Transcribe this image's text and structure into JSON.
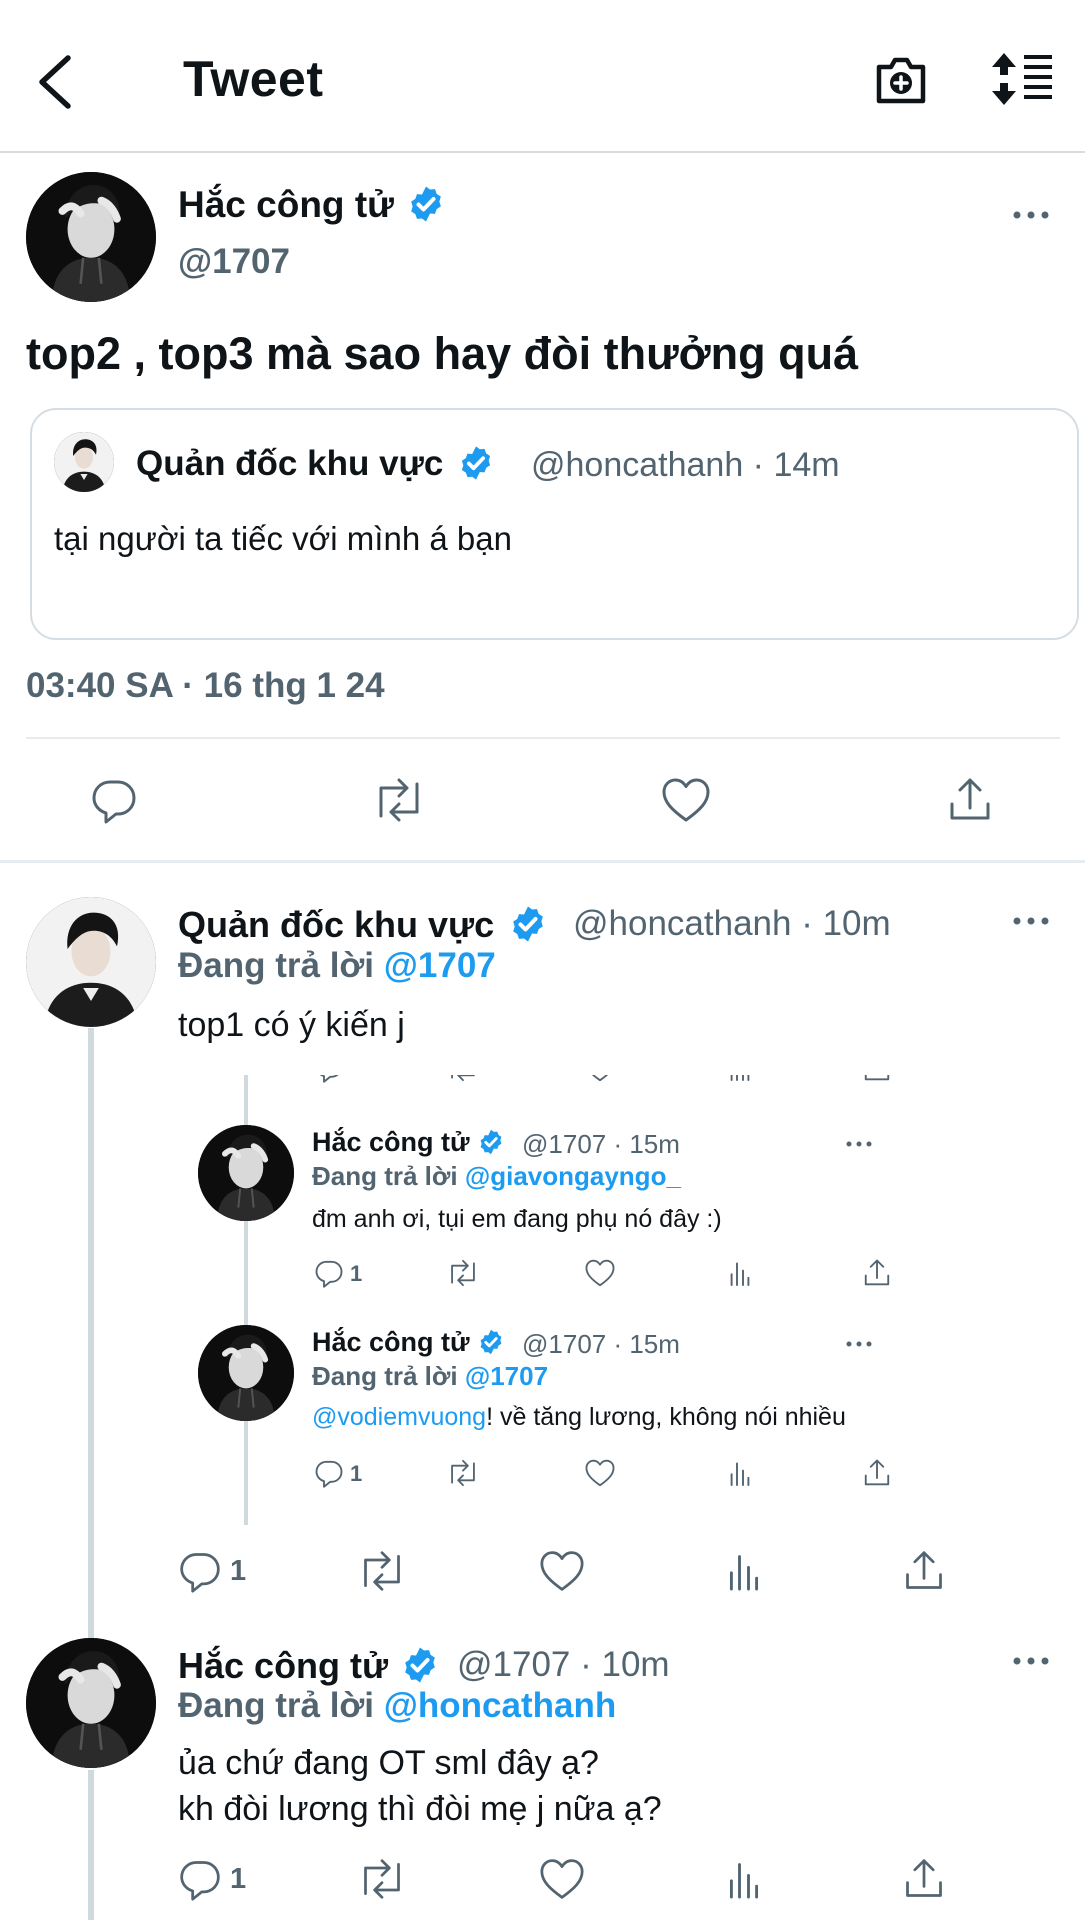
{
  "header": {
    "title": "Tweet"
  },
  "main_tweet": {
    "name": "Hắc công tử",
    "handle": "@1707",
    "text": "top2 , top3 mà sao hay đòi thưởng quá",
    "timestamp": "03:40 SA · 16 thg 1 24",
    "quote": {
      "name": "Quản đốc khu vực",
      "handle_time": "@honcathanh · 14m",
      "text": "tại người ta tiếc với mình á bạn"
    }
  },
  "reply1": {
    "name": "Quản đốc khu vực",
    "handle_time": "@honcathanh · 10m",
    "replying_prefix": "Đang trả lời",
    "replying_to": "@1707",
    "text": "top1 có ý kiến j",
    "reply_count": "1",
    "embedded_screenshot": {
      "items": [
        {
          "name": "Hắc công tử",
          "handle_time": "@1707 · 15m",
          "replying_prefix": "Đang trả lời",
          "replying_to": "@giavongayngo_",
          "text": "đm anh ơi, tụi em đang phụ nó đây :)",
          "mention": "",
          "reply_count": "1"
        },
        {
          "name": "Hắc công tử",
          "handle_time": "@1707 · 15m",
          "replying_prefix": "Đang trả lời",
          "replying_to": "@1707",
          "mention": "@vodiemvuong",
          "text": "! về tăng lương, không nói nhiều",
          "reply_count": "1"
        }
      ]
    }
  },
  "reply2": {
    "name": "Hắc công tử",
    "handle_time": "@1707 · 10m",
    "replying_prefix": "Đang trả lời",
    "replying_to": "@honcathanh",
    "line1": "ủa chứ đang OT sml đây ạ?",
    "line2": "kh đòi lương thì đòi mẹ j nữa ạ?",
    "reply_count": "1"
  },
  "colors": {
    "accent": "#1d9bf0",
    "secondary_text": "#536471",
    "divider": "#e6ecf0"
  },
  "icons": [
    "back-arrow-icon",
    "camera-plus-icon",
    "sort-icon",
    "verified-badge-icon",
    "more-icon",
    "reply-icon",
    "retweet-icon",
    "like-icon",
    "views-icon",
    "share-icon"
  ]
}
